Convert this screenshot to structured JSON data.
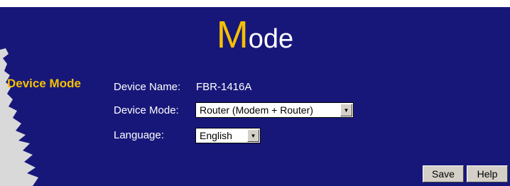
{
  "title": {
    "initial": "M",
    "rest": "ode"
  },
  "section": {
    "label": "Device Mode"
  },
  "fields": {
    "device_name": {
      "label": "Device Name:",
      "value": "FBR-1416A"
    },
    "device_mode": {
      "label": "Device Mode:",
      "value": "Router (Modem + Router)"
    },
    "language": {
      "label": "Language:",
      "value": "English"
    }
  },
  "buttons": {
    "save": "Save",
    "help": "Help"
  },
  "colors": {
    "panel": "#17177a",
    "accent": "#f5c000",
    "text": "#ffffff"
  },
  "icons": {
    "dropdown": "triangle-down-icon"
  }
}
